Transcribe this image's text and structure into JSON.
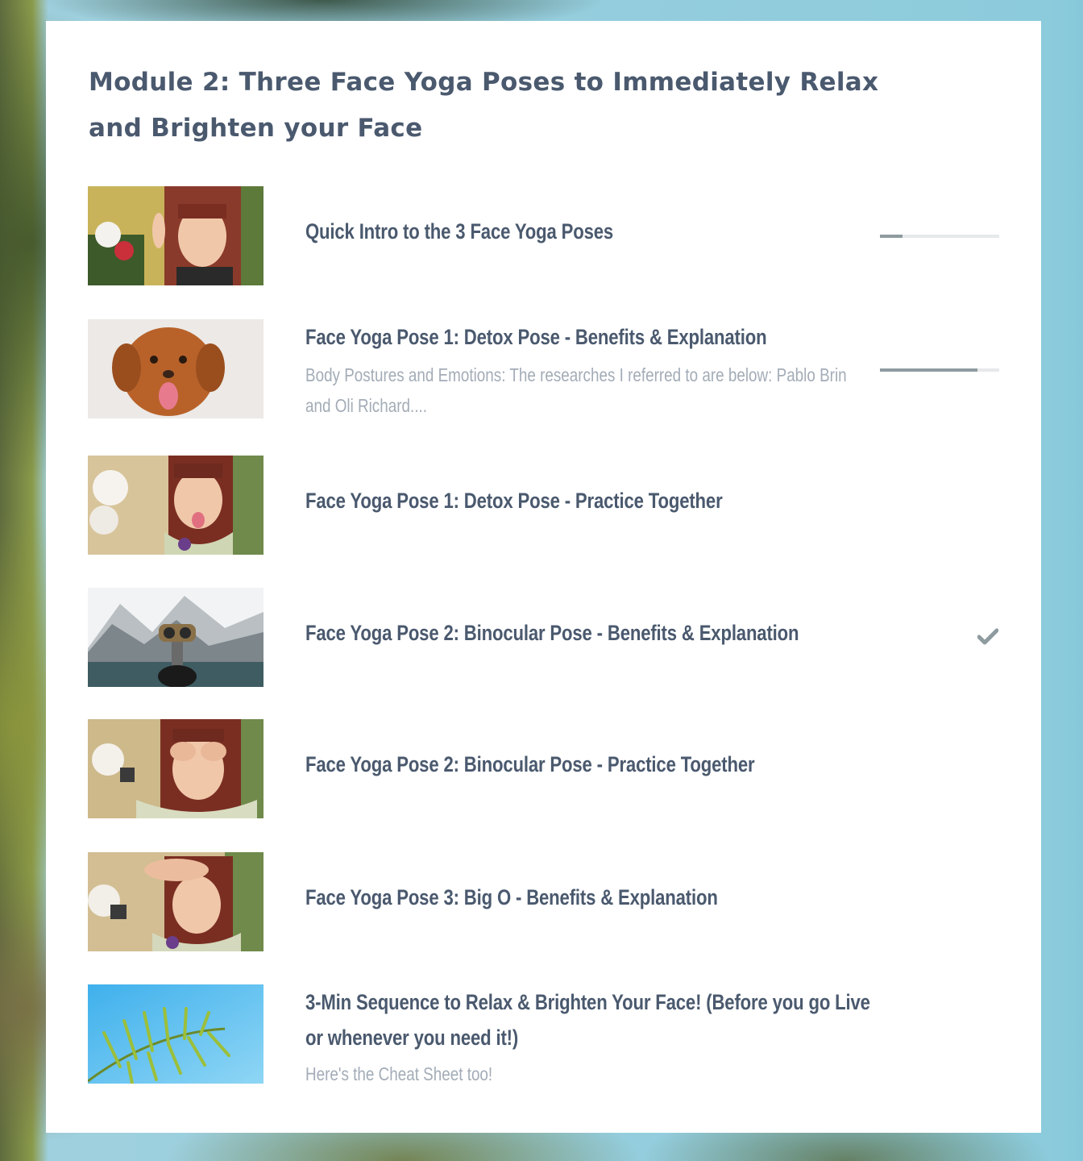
{
  "module": {
    "title": "Module 2: Three Face Yoga Poses to Immediately Relax and Brighten your Face"
  },
  "lessons": [
    {
      "title": "Quick Intro to the 3 Face Yoga Poses",
      "subtitle": "",
      "progress": 0.19,
      "thumb": "woman-waving-thumbnail"
    },
    {
      "title": "Face Yoga Pose 1: Detox Pose - Benefits & Explanation",
      "subtitle": "Body Postures and Emotions: The researches I referred to are below: Pablo Brin and Oli Richard....",
      "progress": 0.82,
      "thumb": "dog-tongue-out-thumbnail"
    },
    {
      "title": "Face Yoga Pose 1: Detox Pose - Practice Together",
      "subtitle": "",
      "thumb": "woman-tongue-out-thumbnail"
    },
    {
      "title": "Face Yoga Pose 2: Binocular Pose - Benefits & Explanation",
      "subtitle": "",
      "completed": true,
      "thumb": "binoculars-lake-thumbnail"
    },
    {
      "title": "Face Yoga Pose 2: Binocular Pose - Practice Together",
      "subtitle": "",
      "thumb": "woman-hand-binoculars-thumbnail"
    },
    {
      "title": "Face Yoga Pose 3: Big O - Benefits & Explanation",
      "subtitle": "",
      "thumb": "woman-hand-forehead-thumbnail"
    },
    {
      "title": "3-Min Sequence to Relax & Brighten Your Face! (Before you go Live or whenever you need it!)",
      "subtitle": "Here's the Cheat Sheet too!",
      "thumb": "palm-leaf-sky-thumbnail"
    }
  ],
  "colors": {
    "title": "#4a596e",
    "subtitle": "#a3acb7",
    "progress_fill": "#8e9b9f",
    "check": "#8e9b9f"
  }
}
